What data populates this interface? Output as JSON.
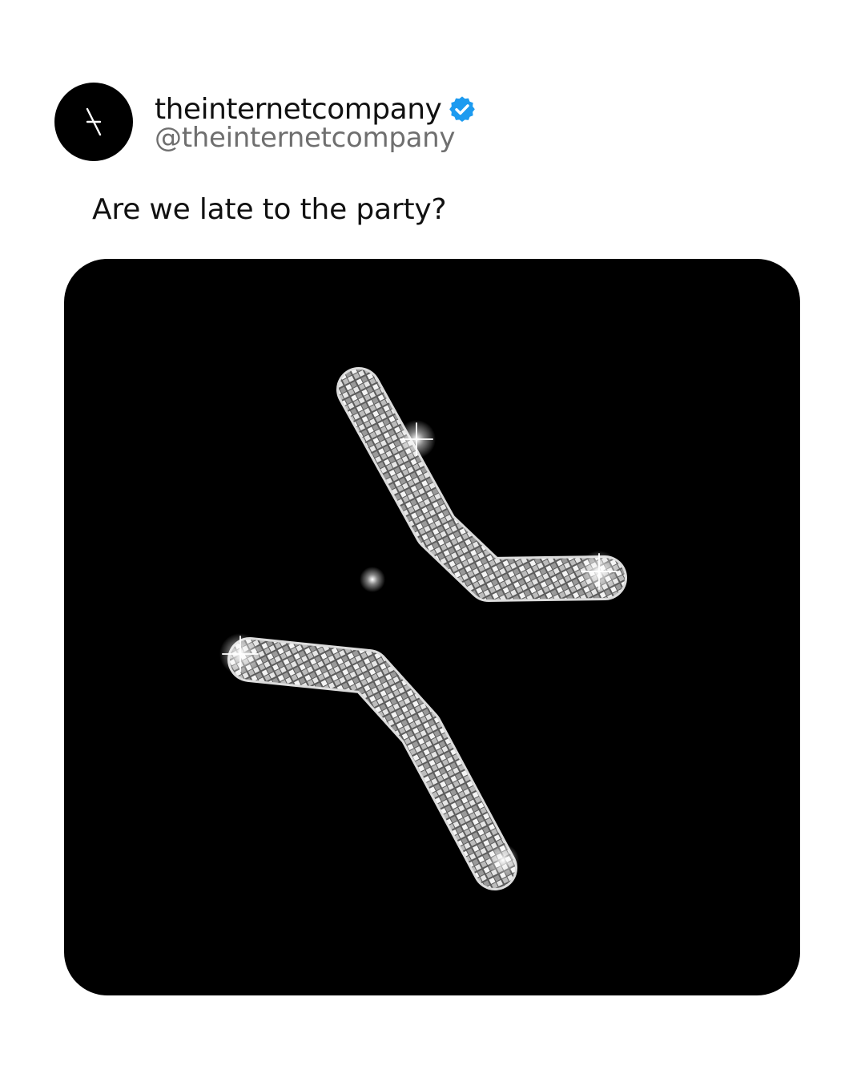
{
  "account": {
    "display_name": "theinternetcompany",
    "handle": "@theinternetcompany",
    "avatar_icon": "theinternetcompany-logo-icon",
    "verified_icon": "verified-badge-icon",
    "verified_color": "#1d9bf0"
  },
  "post": {
    "text": "Are we late to the party?",
    "media_icon": "disco-ball-logo-icon",
    "media_background": "#000000"
  },
  "colors": {
    "background": "#ffffff",
    "text": "#111111",
    "handle": "#6f6f6f"
  }
}
